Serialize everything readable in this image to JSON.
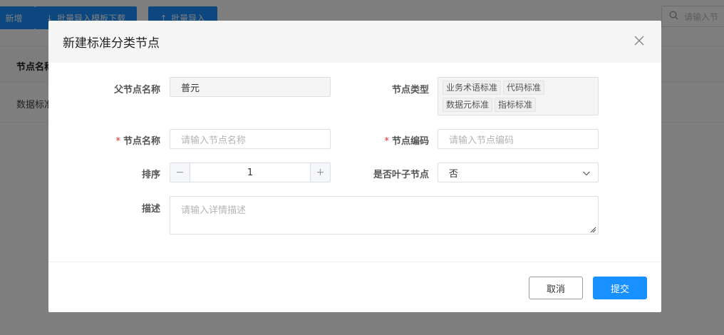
{
  "background": {
    "toolbar": {
      "add_label": "新增",
      "template_label": "批量导入模板下载",
      "import_label": "批量导入"
    },
    "search": {
      "placeholder": "请输入节"
    },
    "table": {
      "header": "节点名称",
      "row_value": "数据标准"
    }
  },
  "modal": {
    "title": "新建标准分类节点",
    "parent_name": {
      "label": "父节点名称",
      "value": "普元"
    },
    "node_type": {
      "label": "节点类型",
      "tags": [
        "业务术语标准",
        "代码标准",
        "数据元标准",
        "指标标准"
      ]
    },
    "node_name": {
      "label": "节点名称",
      "required_mark": "*",
      "placeholder": "请输入节点名称"
    },
    "node_code": {
      "label": "节点编码",
      "required_mark": "*",
      "placeholder": "请输入节点编码"
    },
    "sort": {
      "label": "排序",
      "value": "1",
      "minus": "−",
      "plus": "+"
    },
    "is_leaf": {
      "label": "是否叶子节点",
      "value": "否"
    },
    "description": {
      "label": "描述",
      "placeholder": "请输入详情描述"
    },
    "buttons": {
      "cancel": "取消",
      "submit": "提交"
    }
  },
  "colors": {
    "primary": "#1890ff",
    "required": "#f5222d",
    "mask": "rgba(0,0,0,0.5)"
  }
}
